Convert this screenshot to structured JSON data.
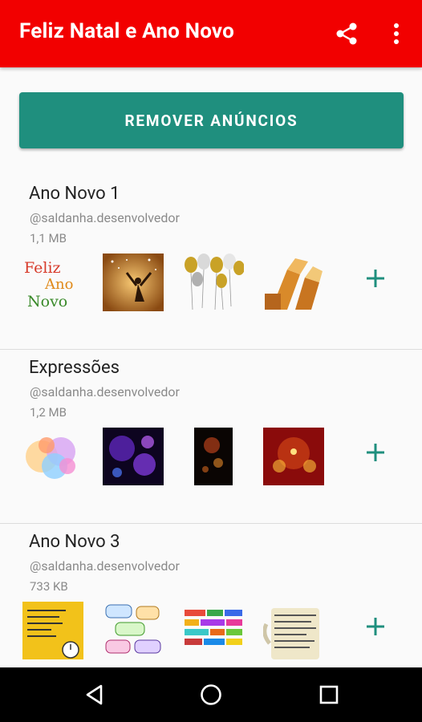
{
  "appbar": {
    "title": "Feliz Natal e Ano Novo",
    "share_icon": "share-icon",
    "more_icon": "more-vert-icon"
  },
  "remove_ads": {
    "label": "REMOVER ANÚNCIOS"
  },
  "packs": [
    {
      "name": "Ano Novo 1",
      "author": "@saldanha.desenvolvedor",
      "size": "1,1 MB",
      "stickers": [
        "feliz-ano-novo-text-sticker",
        "celebrating-person-sticker",
        "gold-balloons-sticker",
        "champagne-toast-sticker"
      ]
    },
    {
      "name": "Expressões",
      "author": "@saldanha.desenvolvedor",
      "size": "1,2 MB",
      "stickers": [
        "colorful-fireworks-sticker",
        "purple-fireworks-sticker",
        "night-fireworks-sticker",
        "red-fireworks-sticker"
      ]
    },
    {
      "name": "Ano Novo 3",
      "author": "@saldanha.desenvolvedor",
      "size": "733 KB",
      "stickers": [
        "yellow-text-card-sticker",
        "speech-bubbles-sticker",
        "colorful-words-sticker",
        "text-mug-sticker"
      ]
    }
  ],
  "add_icon": "plus-icon",
  "nav": {
    "back_icon": "back-triangle-icon",
    "home_icon": "home-circle-icon",
    "recent_icon": "recents-square-icon"
  },
  "colors": {
    "appbar": "#f20000",
    "button": "#1f8f7e",
    "plus": "#1f8f7e"
  }
}
